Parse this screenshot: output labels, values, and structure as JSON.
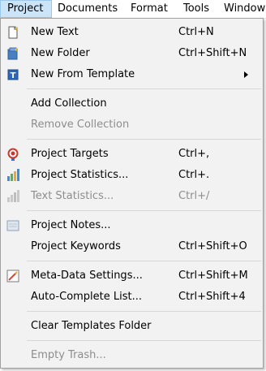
{
  "menubar": {
    "items": [
      {
        "label": "Project"
      },
      {
        "label": "Documents"
      },
      {
        "label": "Format"
      },
      {
        "label": "Tools"
      },
      {
        "label": "Window"
      }
    ]
  },
  "menu": {
    "new_text": {
      "label": "New Text",
      "shortcut": "Ctrl+N"
    },
    "new_folder": {
      "label": "New Folder",
      "shortcut": "Ctrl+Shift+N"
    },
    "new_from_template": {
      "label": "New From Template"
    },
    "add_collection": {
      "label": "Add Collection"
    },
    "remove_collection": {
      "label": "Remove Collection"
    },
    "project_targets": {
      "label": "Project Targets",
      "shortcut": "Ctrl+,"
    },
    "project_statistics": {
      "label": "Project Statistics...",
      "shortcut": "Ctrl+."
    },
    "text_statistics": {
      "label": "Text Statistics...",
      "shortcut": "Ctrl+/"
    },
    "project_notes": {
      "label": "Project Notes..."
    },
    "project_keywords": {
      "label": "Project Keywords",
      "shortcut": "Ctrl+Shift+O"
    },
    "metadata_settings": {
      "label": "Meta-Data Settings...",
      "shortcut": "Ctrl+Shift+M"
    },
    "autocomplete_list": {
      "label": "Auto-Complete List...",
      "shortcut": "Ctrl+Shift+4"
    },
    "clear_templates": {
      "label": "Clear Templates Folder"
    },
    "empty_trash": {
      "label": "Empty Trash..."
    }
  },
  "colors": {
    "menu_background": "#f2f2f2",
    "active_menubar_item": "#cce4f7",
    "disabled_text": "#8d8d8d"
  }
}
